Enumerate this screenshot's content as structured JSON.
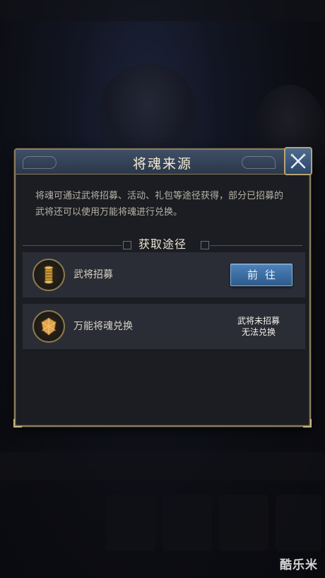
{
  "dialog": {
    "title": "将魂来源",
    "description": "将魂可通过武将招募、活动、礼包等途径获得，部分已招募的武将还可以使用万能将魂进行兑换。",
    "section_title": "获取途径",
    "close_icon": "close-x-icon",
    "rows": [
      {
        "icon": "scroll-icon",
        "label": "武将招募",
        "button_label": "前往"
      },
      {
        "icon": "soul-fragment-icon",
        "label": "万能将魂兑换",
        "status_line1": "武将未招募",
        "status_line2": "无法兑换"
      }
    ]
  },
  "watermark": "酷乐米",
  "colors": {
    "frame_gold": "#8a7d5e",
    "title_blue": "#2b374a",
    "button_blue": "#2d5b8d",
    "panel_bg": "#1b1d22"
  }
}
